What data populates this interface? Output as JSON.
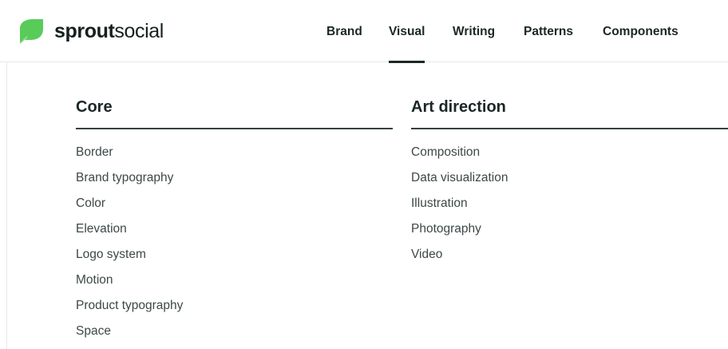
{
  "header": {
    "logo": {
      "brand_bold": "sprout",
      "brand_light": "social",
      "icon": "sprout-leaf-icon"
    },
    "nav": [
      {
        "label": "Brand",
        "active": false
      },
      {
        "label": "Visual",
        "active": true
      },
      {
        "label": "Writing",
        "active": false
      },
      {
        "label": "Patterns",
        "active": false
      },
      {
        "label": "Components",
        "active": false
      }
    ]
  },
  "menu": {
    "core": {
      "title": "Core",
      "items": [
        "Border",
        "Brand typography",
        "Color",
        "Elevation",
        "Logo system",
        "Motion",
        "Product typography",
        "Space"
      ]
    },
    "art_direction": {
      "title": "Art direction",
      "items": [
        "Composition",
        "Data visualization",
        "Illustration",
        "Photography",
        "Video"
      ]
    }
  },
  "colors": {
    "brand_green": "#59cb59",
    "text_dark": "#1b2727",
    "text_body": "#3d4848",
    "rule": "#364141"
  }
}
